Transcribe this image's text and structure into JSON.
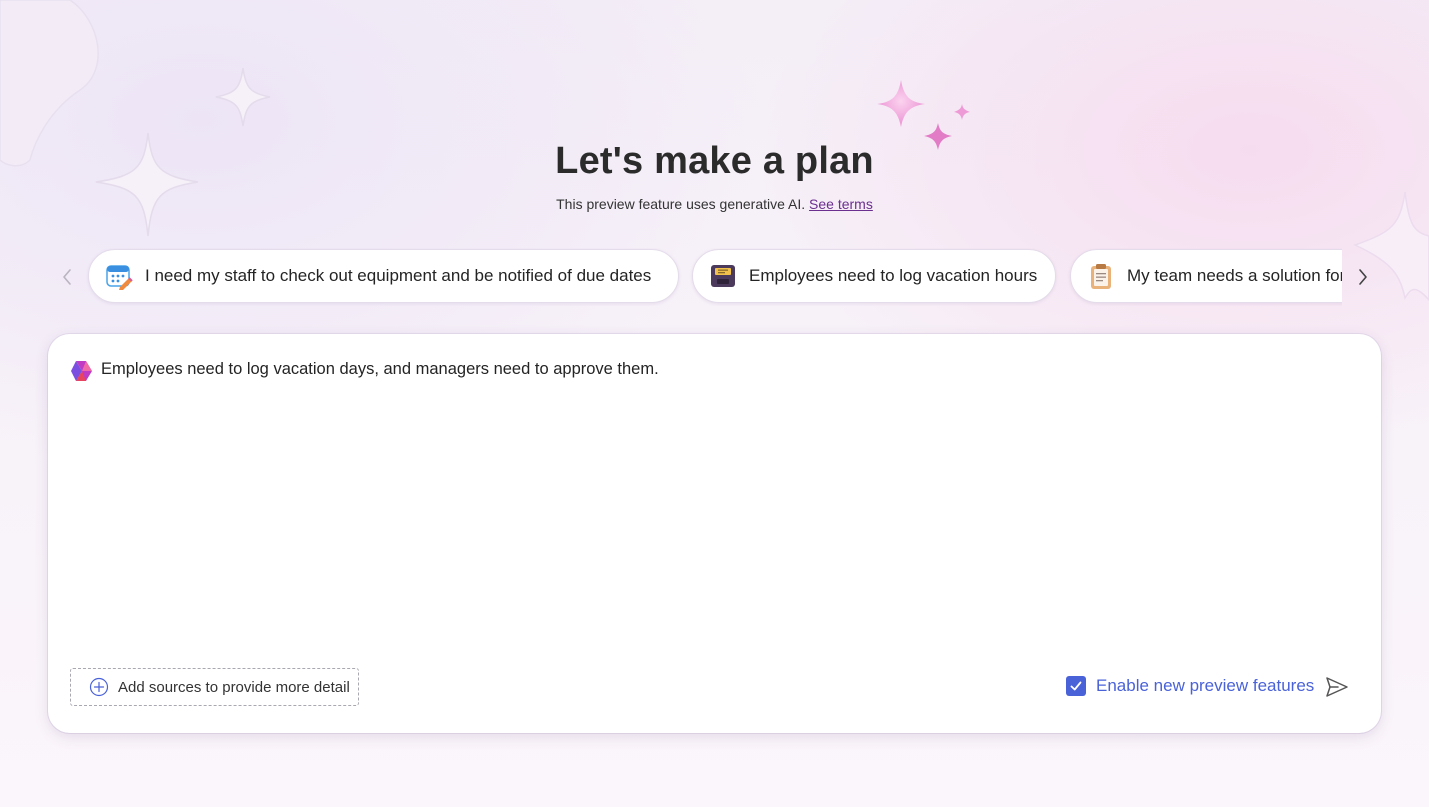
{
  "header": {
    "title": "Let's make a plan",
    "subtitle": "This preview feature uses generative AI.",
    "terms_link": "See terms"
  },
  "suggestions": [
    {
      "label": "I need my staff to check out equipment and be notified of due dates",
      "icon": "calendar-edit-icon"
    },
    {
      "label": "Employees need to log vacation hours",
      "icon": "suitcase-icon"
    },
    {
      "label": "My team needs a solution for",
      "icon": "clipboard-icon"
    }
  ],
  "prompt": {
    "text": "Employees need to log vacation days, and managers need to approve them.",
    "logo": "power-apps-logo-icon"
  },
  "footer": {
    "add_sources_label": "Add sources to provide more detail",
    "preview_features_label": "Enable new preview features",
    "preview_features_checked": true
  },
  "colors": {
    "accent": "#4a62d8",
    "link": "#6b2f8f",
    "sparkle": "#e98ad0"
  }
}
